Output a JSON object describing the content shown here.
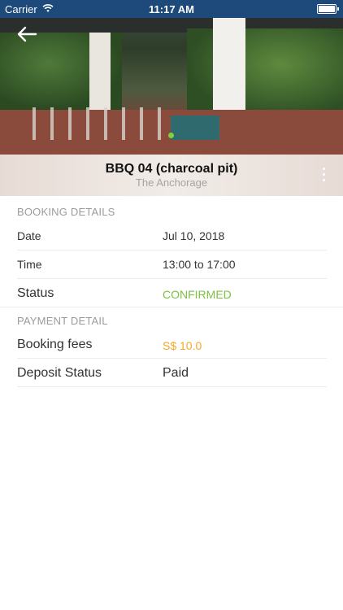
{
  "status_bar": {
    "carrier": "Carrier",
    "time": "11:17 AM",
    "battery_level": 1.0
  },
  "header": {
    "title": "BBQ 04 (charcoal pit)",
    "subtitle": "The Anchorage",
    "back_icon": "arrow-left-icon",
    "menu_icon": "more-vertical-icon"
  },
  "booking_details": {
    "heading": "BOOKING DETAILS",
    "rows": [
      {
        "label": "Date",
        "value": "Jul 10, 2018"
      },
      {
        "label": "Time",
        "value": "13:00 to 17:00"
      },
      {
        "label": "Status",
        "value": "CONFIRMED"
      }
    ]
  },
  "payment_detail": {
    "heading": "PAYMENT DETAIL",
    "rows": [
      {
        "label": "Booking fees",
        "value": "S$ 10.0"
      },
      {
        "label": "Deposit Status",
        "value": "Paid"
      }
    ]
  },
  "colors": {
    "status_confirmed": "#7dc142",
    "fee_accent": "#f5a623",
    "status_bar_bg": "#1d4a7a"
  }
}
